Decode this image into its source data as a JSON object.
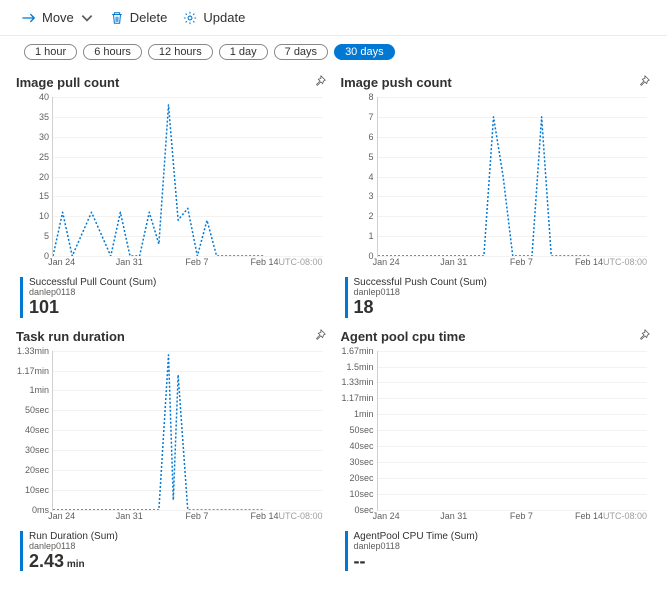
{
  "toolbar": {
    "move": "Move",
    "delete": "Delete",
    "update": "Update"
  },
  "time_filter": {
    "options": [
      "1 hour",
      "6 hours",
      "12 hours",
      "1 day",
      "7 days",
      "30 days"
    ],
    "active_index": 5
  },
  "x_axis": {
    "ticks": [
      "Jan 24",
      "Jan 31",
      "Feb 7",
      "Feb 14"
    ],
    "timezone": "UTC-08:00"
  },
  "cards": [
    {
      "title": "Image pull count",
      "legend_label": "Successful Pull Count (Sum)",
      "legend_sub": "danlep0118",
      "value": "101",
      "unit": "",
      "y_ticks": [
        "40",
        "35",
        "30",
        "25",
        "20",
        "15",
        "10",
        "5",
        "0"
      ]
    },
    {
      "title": "Image push count",
      "legend_label": "Successful Push Count (Sum)",
      "legend_sub": "danlep0118",
      "value": "18",
      "unit": "",
      "y_ticks": [
        "8",
        "7",
        "6",
        "5",
        "4",
        "3",
        "2",
        "1",
        "0"
      ]
    },
    {
      "title": "Task run duration",
      "legend_label": "Run Duration (Sum)",
      "legend_sub": "danlep0118",
      "value": "2.43",
      "unit": " min",
      "y_ticks": [
        "1.33min",
        "1.17min",
        "1min",
        "50sec",
        "40sec",
        "30sec",
        "20sec",
        "10sec",
        "0ms"
      ]
    },
    {
      "title": "Agent pool cpu time",
      "legend_label": "AgentPool CPU Time (Sum)",
      "legend_sub": "danlep0118",
      "value": "--",
      "unit": "",
      "y_ticks": [
        "1.67min",
        "1.5min",
        "1.33min",
        "1.17min",
        "1min",
        "50sec",
        "40sec",
        "30sec",
        "20sec",
        "10sec",
        "0sec"
      ]
    }
  ],
  "chart_data": [
    {
      "type": "line",
      "title": "Image pull count",
      "xlabel": "",
      "ylabel": "",
      "ylim": [
        0,
        40
      ],
      "x_ticks": [
        "Jan 24",
        "Jan 31",
        "Feb 7",
        "Feb 14"
      ],
      "series": [
        {
          "name": "Successful Pull Count (Sum)",
          "points": [
            {
              "x": "Jan 23",
              "y": 0
            },
            {
              "x": "Jan 24",
              "y": 11
            },
            {
              "x": "Jan 25",
              "y": 0
            },
            {
              "x": "Jan 27",
              "y": 11
            },
            {
              "x": "Jan 29",
              "y": 0
            },
            {
              "x": "Jan 30",
              "y": 11
            },
            {
              "x": "Jan 31",
              "y": 0
            },
            {
              "x": "Feb 1",
              "y": 0
            },
            {
              "x": "Feb 2",
              "y": 11
            },
            {
              "x": "Feb 3",
              "y": 3
            },
            {
              "x": "Feb 4",
              "y": 38
            },
            {
              "x": "Feb 5",
              "y": 9
            },
            {
              "x": "Feb 6",
              "y": 12
            },
            {
              "x": "Feb 7",
              "y": 0
            },
            {
              "x": "Feb 8",
              "y": 9
            },
            {
              "x": "Feb 9",
              "y": 0
            },
            {
              "x": "Feb 14",
              "y": 0
            }
          ]
        }
      ]
    },
    {
      "type": "line",
      "title": "Image push count",
      "xlabel": "",
      "ylabel": "",
      "ylim": [
        0,
        8
      ],
      "x_ticks": [
        "Jan 24",
        "Jan 31",
        "Feb 7",
        "Feb 14"
      ],
      "series": [
        {
          "name": "Successful Push Count (Sum)",
          "points": [
            {
              "x": "Jan 23",
              "y": 0
            },
            {
              "x": "Feb 3",
              "y": 0
            },
            {
              "x": "Feb 4",
              "y": 7
            },
            {
              "x": "Feb 5",
              "y": 4
            },
            {
              "x": "Feb 6",
              "y": 0
            },
            {
              "x": "Feb 8",
              "y": 0
            },
            {
              "x": "Feb 9",
              "y": 7
            },
            {
              "x": "Feb 10",
              "y": 0
            },
            {
              "x": "Feb 14",
              "y": 0
            }
          ]
        }
      ]
    },
    {
      "type": "line",
      "title": "Task run duration",
      "xlabel": "",
      "ylabel": "",
      "ylim": [
        0,
        80
      ],
      "y_unit": "sec",
      "x_ticks": [
        "Jan 24",
        "Jan 31",
        "Feb 7",
        "Feb 14"
      ],
      "series": [
        {
          "name": "Run Duration (Sum)",
          "points": [
            {
              "x": "Jan 23",
              "y": 0
            },
            {
              "x": "Feb 3",
              "y": 0
            },
            {
              "x": "Feb 4",
              "y": 78
            },
            {
              "x": "Feb 4.5",
              "y": 5
            },
            {
              "x": "Feb 5",
              "y": 68
            },
            {
              "x": "Feb 6",
              "y": 0
            },
            {
              "x": "Feb 14",
              "y": 0
            }
          ]
        }
      ]
    },
    {
      "type": "line",
      "title": "Agent pool cpu time",
      "xlabel": "",
      "ylabel": "",
      "ylim": [
        0,
        100
      ],
      "y_unit": "sec",
      "x_ticks": [
        "Jan 24",
        "Jan 31",
        "Feb 7",
        "Feb 14"
      ],
      "series": [
        {
          "name": "AgentPool CPU Time (Sum)",
          "points": []
        }
      ]
    }
  ]
}
